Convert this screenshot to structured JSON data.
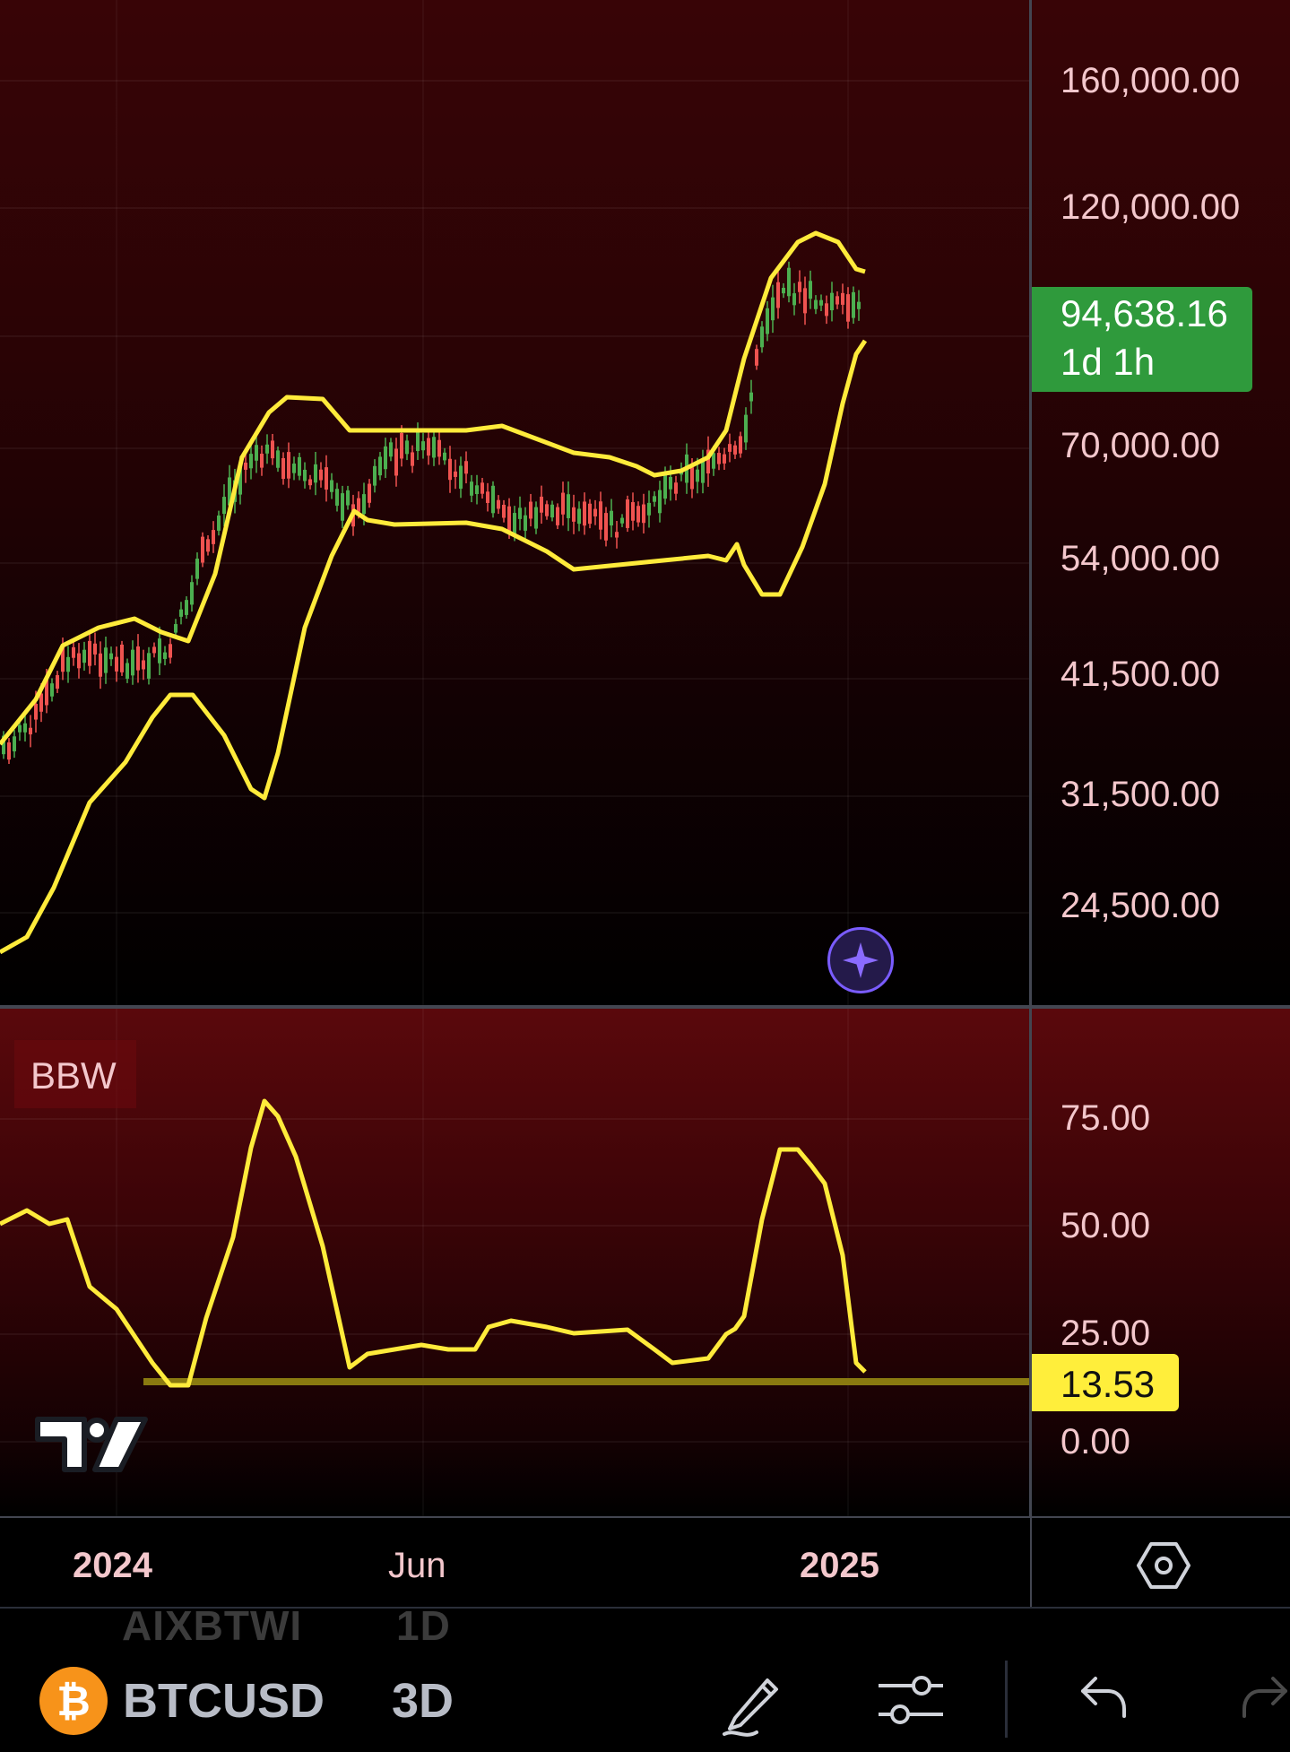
{
  "chart": {
    "symbol": "BTCUSD",
    "interval": "3D",
    "ghost_symbol": "AIXBTWI",
    "ghost_interval": "1D",
    "price_scale": {
      "ticks": [
        "160,000.00",
        "120,000.00",
        "70,000.00",
        "54,000.00",
        "41,500.00",
        "31,500.00",
        "24,500.00"
      ],
      "current_price": "94,638.16",
      "countdown": "1d 1h"
    },
    "indicator": {
      "name": "BBW",
      "ticks": [
        "75.00",
        "50.00",
        "25.00",
        "0.00"
      ],
      "current_value": "13.53"
    },
    "time_axis": {
      "labels": [
        "2024",
        "Jun",
        "2025"
      ]
    },
    "colors": {
      "up_candle": "#4caf50",
      "down_candle": "#ef5350",
      "band_line": "#ffeb3b",
      "price_badge": "#2f9a3c",
      "bbw_badge": "#ffee3b",
      "ai_button": "#7a5cff"
    }
  },
  "chart_data": [
    {
      "type": "line",
      "ylim": [
        24500,
        160000
      ],
      "x": [
        "2023-12",
        "2024-01",
        "2024-02",
        "2024-03",
        "2024-04",
        "2024-05",
        "2024-06",
        "2024-07",
        "2024-08",
        "2024-09",
        "2024-10",
        "2024-11",
        "2024-12",
        "2025-01"
      ],
      "series": [
        {
          "values": [
            38000,
            40000,
            43000,
            52000,
            70000,
            66000,
            69000,
            64000,
            59000,
            57500,
            62000,
            80000,
            98000,
            94638.16
          ]
        }
      ]
    },
    {
      "type": "line",
      "ylim": [
        0,
        75
      ],
      "x": [
        "2023-12",
        "2024-01",
        "2024-02",
        "2024-03",
        "2024-04",
        "2024-05",
        "2024-06",
        "2024-07",
        "2024-08",
        "2024-09",
        "2024-10",
        "2024-11",
        "2024-12",
        "2025-01"
      ],
      "series": [
        {
          "name": "BBW",
          "values": [
            50,
            35,
            15,
            72,
            45,
            20,
            21,
            25,
            23,
            17,
            28,
            65,
            52,
            13.53
          ]
        }
      ]
    }
  ],
  "toolbar": {
    "icons": [
      "draw-icon",
      "indicator-settings-icon",
      "undo-icon",
      "redo-icon"
    ]
  }
}
